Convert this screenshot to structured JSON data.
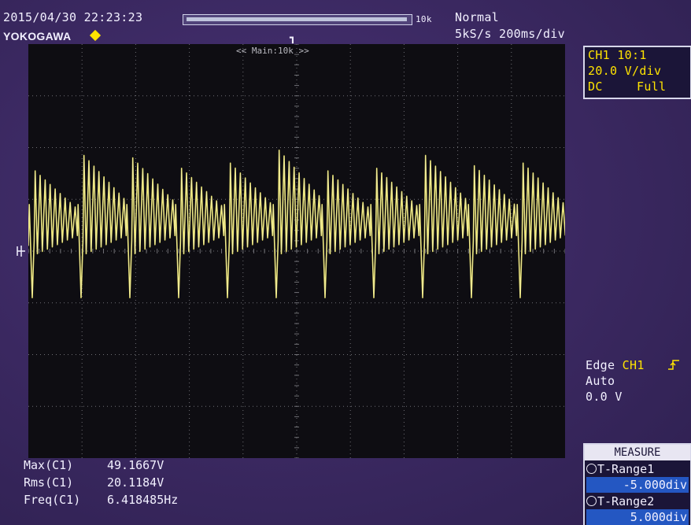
{
  "header": {
    "timestamp": "2015/04/30 22:23:23",
    "brand": "YOKOGAWA",
    "record_length": "10k",
    "mode": "Normal",
    "timebase": "5kS/s 200ms/div",
    "trigger_position_icon": "trigger-position-icon"
  },
  "display": {
    "zoom_label": "<< Main:10k >>",
    "trace_color": "#e8e060",
    "grid_color": "#6f6f74"
  },
  "channel_panel": {
    "line1": "CH1 10:1",
    "line2": "20.0 V/div",
    "coupling": "DC",
    "bandwidth": "Full"
  },
  "trigger": {
    "type_label": "Edge",
    "source": "CH1",
    "mode": "Auto",
    "level": "0.0 V",
    "slope_icon": "rising-edge-icon"
  },
  "measurements": [
    {
      "label": "Max(C1)",
      "value": "49.1667V"
    },
    {
      "label": "Rms(C1)",
      "value": "20.1184V"
    },
    {
      "label": "Freq(C1)",
      "value": "6.418485Hz"
    }
  ],
  "measure_menu": {
    "title": "MEASURE",
    "range1_label": "T-Range1",
    "range1_value": "-5.000div",
    "range2_label": "T-Range2",
    "range2_value": "5.000div"
  },
  "chart_data": {
    "type": "line",
    "title": "",
    "xlabel": "",
    "ylabel": "",
    "x_divisions": 10,
    "y_divisions": 8,
    "xlim": [
      -5,
      5
    ],
    "ylim": [
      -4,
      4
    ],
    "series": [
      {
        "cycles": 11,
        "peak_div": [
          1.55,
          1.85,
          1.8,
          1.6,
          1.7,
          1.95,
          1.55,
          1.6,
          1.85,
          1.65,
          1.7
        ],
        "trough_div": -0.9,
        "ripple_teeth_per_cycle": 9
      }
    ]
  }
}
